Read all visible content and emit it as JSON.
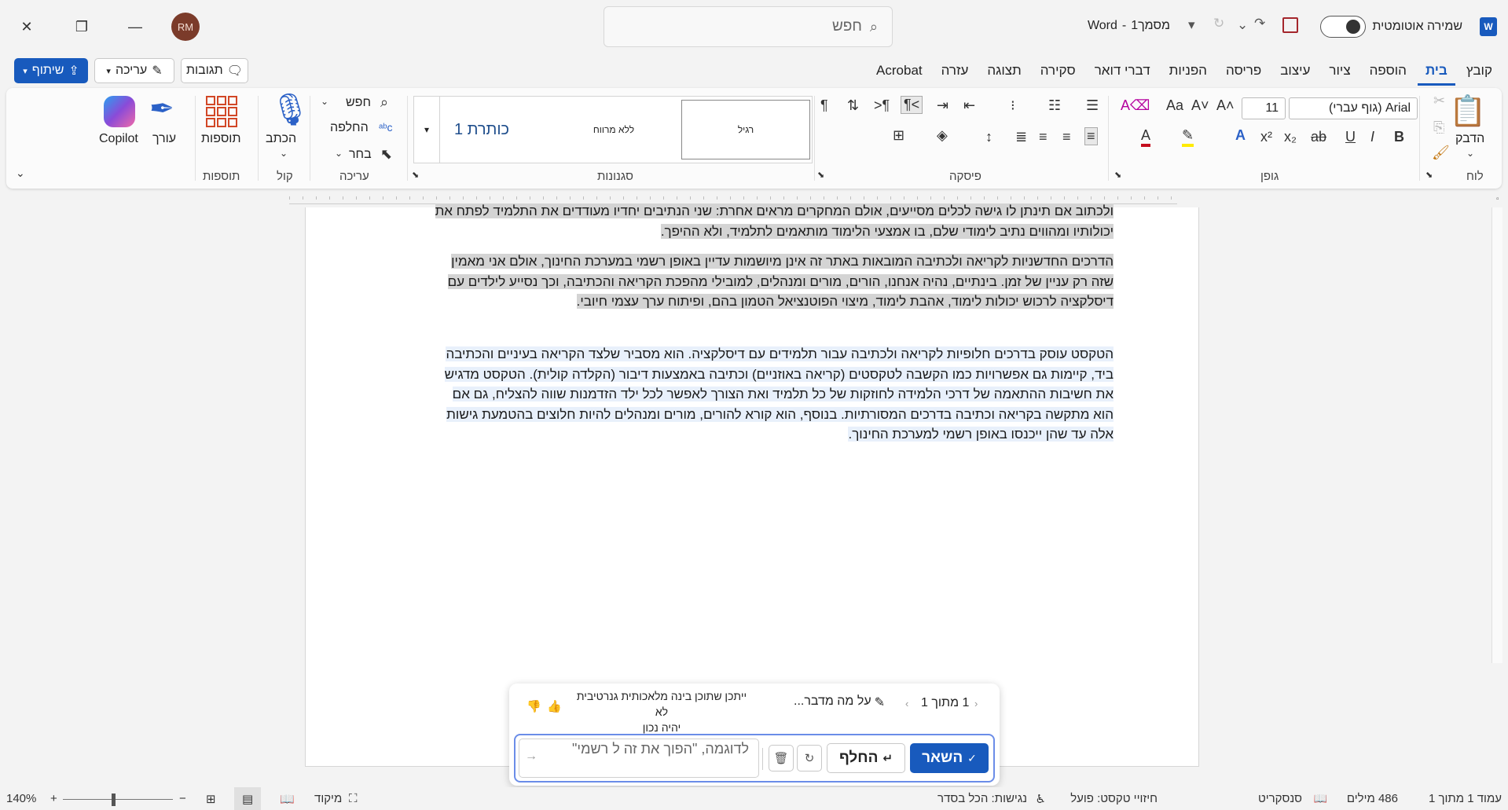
{
  "titlebar": {
    "app_name": "Word",
    "doc_name": "מסמך1",
    "separator": "-",
    "autosave_label": "שמירה אוטומטית",
    "search_placeholder": "חפש",
    "avatar_initials": "RM"
  },
  "tabs": [
    "קובץ",
    "בית",
    "הוספה",
    "ציור",
    "עיצוב",
    "פריסה",
    "הפניות",
    "דברי דואר",
    "סקירה",
    "תצוגה",
    "עזרה",
    "Acrobat"
  ],
  "active_tab": "בית",
  "actions": {
    "share": "שיתוף",
    "edit": "עריכה",
    "comments": "תגובות"
  },
  "ribbon": {
    "clipboard": {
      "label": "לוח",
      "paste": "הדבק"
    },
    "font": {
      "label": "גופן",
      "font_name": "Arial (גוף עברי)",
      "font_size": "11"
    },
    "paragraph": {
      "label": "פיסקה"
    },
    "styles": {
      "label": "סגנונות",
      "items": [
        "רגיל",
        "ללא מרווח",
        "כותרת 1"
      ]
    },
    "editing": {
      "label": "עריכה",
      "find": "חפש",
      "replace": "החלפה",
      "select": "בחר"
    },
    "voice": {
      "label": "קול",
      "dictate": "הכתב"
    },
    "addins": {
      "label": "תוספות",
      "addins": "תוספות",
      "editor": "עורך",
      "copilot": "Copilot"
    }
  },
  "document": {
    "para1": "ולכתוב אם תינתן לו גישה לכלים מסייעים, אולם המחקרים מראים אחרת: שני הנתיבים יחדיו מעודדים את התלמיד לפתח את יכולותיו ומהווים נתיב לימודי שלם, בו אמצעי הלימוד מותאמים לתלמיד, ולא ההיפך.",
    "para2": "הדרכים החדשניות לקריאה ולכתיבה המובאות באתר זה אינן מיושמות עדיין באופן רשמי במערכת החינוך, אולם אני מאמין שזה רק עניין של זמן. בינתיים, נהיה אנחנו, הורים, מורים ומנהלים, למובילי מהפכת הקריאה והכתיבה, וכך נסייע לילדים עם דיסלקציה לרכוש יכולות לימוד, אהבת לימוד, מיצוי הפוטנציאל הטמון בהם, ופיתוח ערך עצמי חיובי.",
    "para3": "הטקסט עוסק בדרכים חלופיות לקריאה ולכתיבה עבור תלמידים עם דיסלקציה. הוא מסביר שלצד הקריאה בעיניים והכתיבה ביד, קיימות גם אפשרויות כמו הקשבה לטקסטים (קריאה באוזניים) וכתיבה באמצעות דיבור (הקלדה קולית). הטקסט מדגיש את חשיבות ההתאמה של דרכי הלמידה לחוזקות של כל תלמיד ואת הצורך לאפשר לכל ילד הזדמנות שווה להצליח, גם אם הוא מתקשה בקריאה וכתיבה בדרכים המסורתיות. בנוסף, הוא קורא להורים, מורים ומנהלים להיות חלוצים בהטמעת גישות אלה עד שהן ייכנסו באופן רשמי למערכת החינוך."
  },
  "copilot": {
    "pager": "1 מתוך 1",
    "topic": "על מה מדבר...",
    "disclaimer_line1": "ייתכן שתוכן בינה מלאכותית גנרטיבית לא",
    "disclaimer_line2": "יהיה נכון",
    "keep": "השאר",
    "replace": "החלף",
    "input_placeholder": "לדוגמה, \"הפוך את זה ל רשמי\""
  },
  "statusbar": {
    "page": "עמוד 1 מתוך 1",
    "words": "486 מילים",
    "language": "סנסקריט",
    "predictions": "חיזויי טקסט: פועל",
    "accessibility": "נגישות: הכל בסדר",
    "focus": "מיקוד",
    "zoom": "140%"
  },
  "colors": {
    "accent": "#185abd",
    "highlight": "#d4d4d4",
    "autosave_icon": "#a4262c"
  }
}
